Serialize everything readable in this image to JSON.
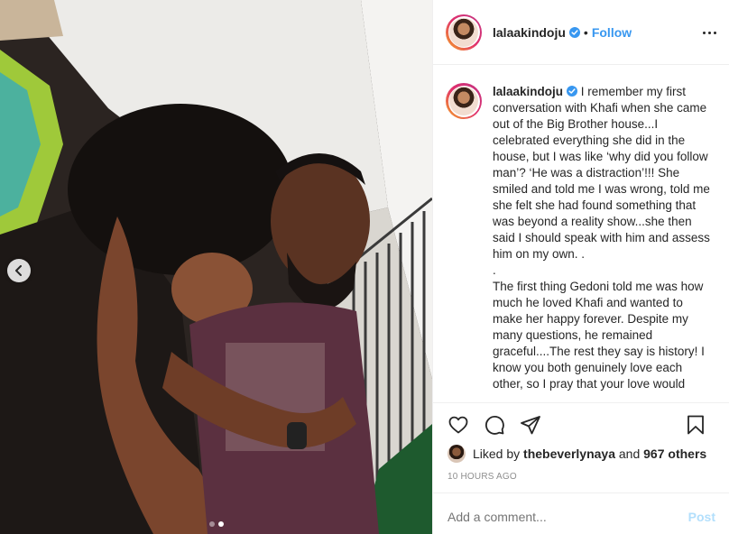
{
  "post": {
    "username": "lalaakindoju",
    "follow_label": "Follow",
    "separator": "•",
    "caption": {
      "username": "lalaakindoju",
      "text": "I remember my first conversation with Khafi when she came out of the Big Brother house...I celebrated everything she did in the house, but I was like ‘why did you follow man’? ‘He was a distraction’!!! She smiled and told me I was wrong, told me she felt she had found something that was beyond a reality show...she then said I should speak with him and assess him on my own. .\n.\nThe first thing Gedoni told me was how much he loved Khafi and wanted to make her happy forever. Despite my many questions, he remained graceful....The rest they say is history! I know you both genuinely love each other, so I pray that your love would"
    },
    "likes": {
      "prefix": "Liked by",
      "user": "thebeverlynaya",
      "and": "and",
      "count_text": "967 others"
    },
    "timestamp": "10 HOURS AGO",
    "comment_placeholder": "Add a comment...",
    "post_label": "Post",
    "carousel": {
      "count": 2,
      "active_index": 1
    }
  },
  "icons": {
    "like": "heart-icon",
    "comment": "comment-icon",
    "share": "share-icon",
    "save": "bookmark-icon",
    "prev": "chevron-left-icon",
    "verified": "verified-badge-icon",
    "more": "more-options-icon"
  },
  "colors": {
    "link_blue": "#3897f0",
    "verified_blue": "#3897f0",
    "post_disabled": "#b2dffc",
    "muted": "#8e8e8e"
  }
}
